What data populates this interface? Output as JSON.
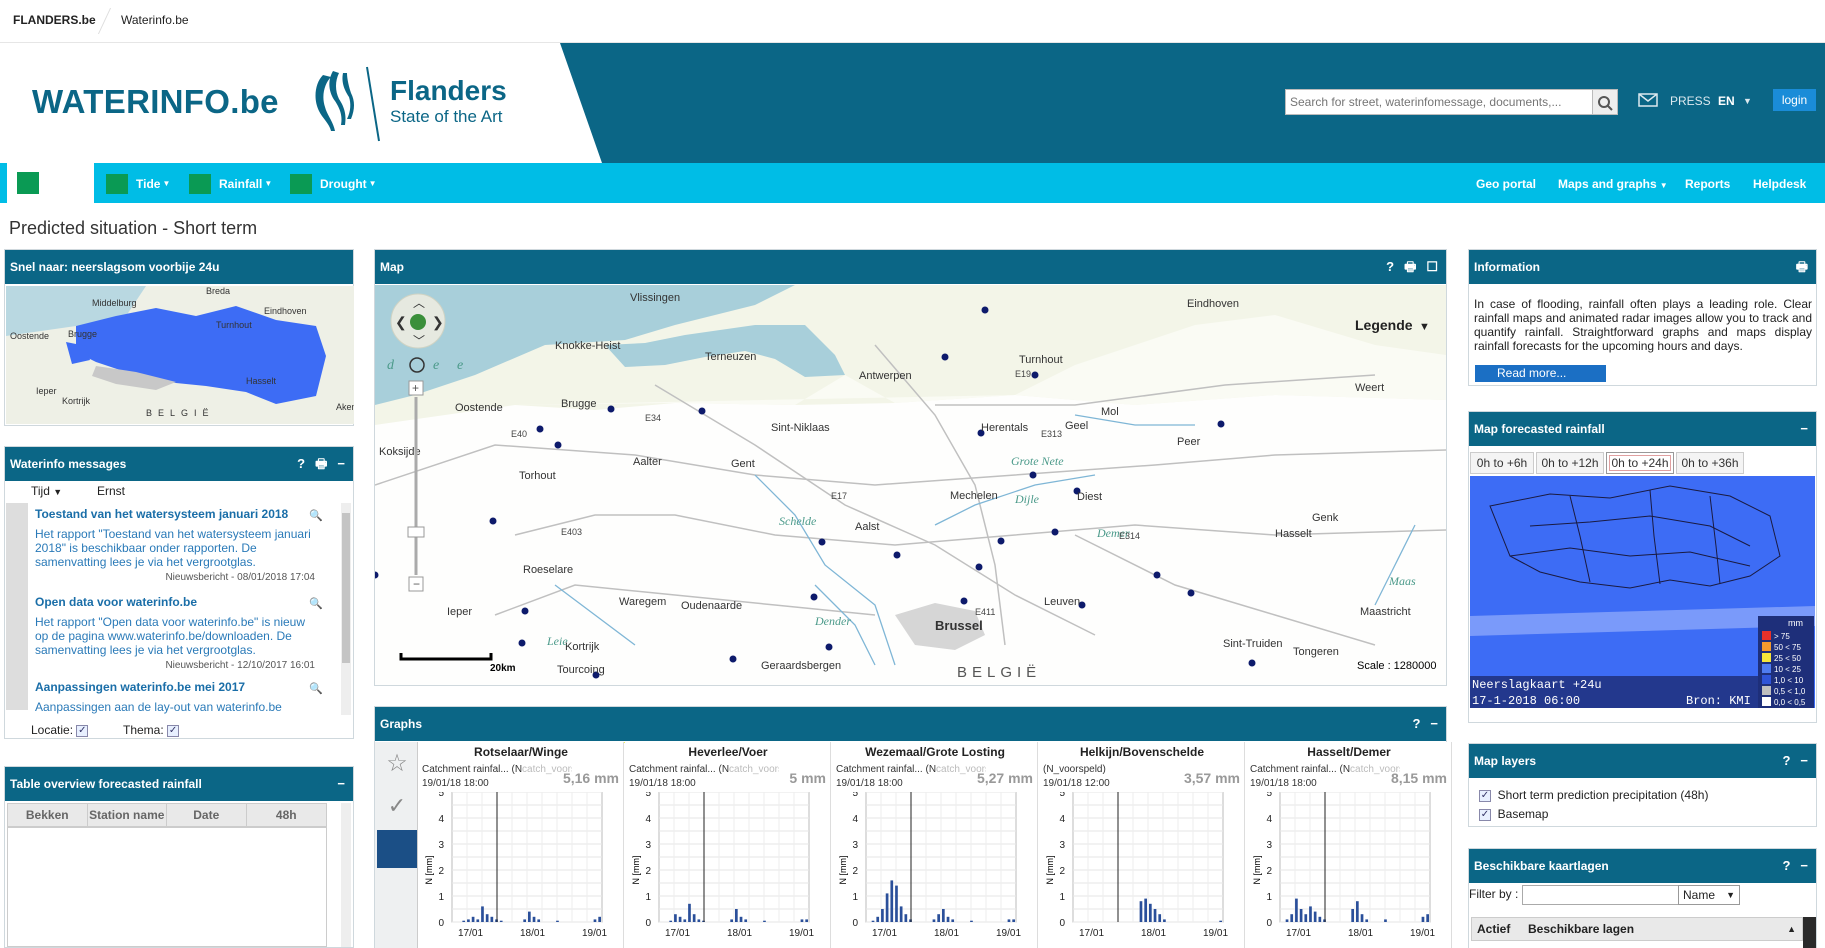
{
  "topbar": {
    "flanders": "FLANDERS.be",
    "waterinfo": "Waterinfo.be"
  },
  "header": {
    "brand": "WATERINFO.be",
    "flanders": "Flanders",
    "state_of_art": "State of the Art",
    "search_placeholder": "Search for street, waterinfomessage, documents,...",
    "press": "PRESS",
    "lang": "EN",
    "login": "login"
  },
  "nav": {
    "items": [
      {
        "label": "Tide"
      },
      {
        "label": "Rainfall"
      },
      {
        "label": "Drought"
      }
    ],
    "right": [
      {
        "label": "Geo portal"
      },
      {
        "label": "Maps and graphs"
      },
      {
        "label": "Reports"
      },
      {
        "label": "Helpdesk"
      }
    ]
  },
  "page_title": "Predicted situation - Short term",
  "snel": {
    "title": "Snel naar: neerslagsom voorbije 24u",
    "places": [
      "Breda",
      "Middelburg",
      "Eindhoven",
      "Oostende",
      "Brugge",
      "Turnhout",
      "Hasselt",
      "Ieper",
      "Kortrijk",
      "BELGIË",
      "Aken"
    ]
  },
  "messages": {
    "title": "Waterinfo messages",
    "col_tijd": "Tijd",
    "col_ernst": "Ernst",
    "items": [
      {
        "title": "Toestand van het watersysteem januari 2018",
        "body": "Het rapport \"Toestand van het watersysteem januari 2018\" is beschikbaar onder rapporten. De samenvatting lees je via het vergrootglas.",
        "date": "Nieuwsbericht - 08/01/2018 17:04"
      },
      {
        "title": "Open data voor waterinfo.be",
        "body": "Het rapport \"Open data voor waterinfo.be\" is nieuw op de pagina www.waterinfo.be/downloaden. De samenvatting lees je via het vergrootglas.",
        "date": "Nieuwsbericht - 12/10/2017 16:01"
      },
      {
        "title": "Aanpassingen waterinfo.be mei 2017",
        "body": "Aanpassingen aan de lay-out van waterinfo.be",
        "date": ""
      }
    ],
    "locatie": "Locatie:",
    "thema": "Thema:"
  },
  "table_overview": {
    "title": "Table overview forecasted rainfall",
    "columns": [
      "Bekken",
      "Station name",
      "Date",
      "48h"
    ]
  },
  "map": {
    "title": "Map",
    "legend": "Legende",
    "scale": "Scale : 1280000",
    "scalebar": "20km",
    "nav_letters": [
      "d",
      "e",
      "e"
    ],
    "cities": [
      "Vlissingen",
      "Knokke-Heist",
      "Terneuzen",
      "Eindhoven",
      "Antwerpen",
      "Turnhout",
      "Oostende",
      "Brugge",
      "Sint-Niklaas",
      "Herentals",
      "Geel",
      "Mol",
      "Weert",
      "Koksijde",
      "Aalter",
      "Gent",
      "Peer",
      "Torhout",
      "Mechelen",
      "Diest",
      "Genk",
      "Roeselare",
      "Aalst",
      "Hasselt",
      "Waregem",
      "Oudenaarde",
      "Leuven",
      "Maastricht",
      "Ieper",
      "Brussel",
      "Kortrijk",
      "Sint-Truiden",
      "Tourcoing",
      "Geraardsbergen",
      "Tongeren",
      "BELGIË"
    ],
    "rivers": [
      "Grote Nete",
      "Dijle",
      "Demer",
      "Schelde",
      "Dender",
      "Leie",
      "Maas"
    ],
    "roads": [
      "E34",
      "E40",
      "E17",
      "E19",
      "E313",
      "E314",
      "E403",
      "E411"
    ]
  },
  "graphs": {
    "title": "Graphs",
    "cards": [
      {
        "title": "Rotselaar/Winge",
        "sub1": "Catchment rainfal... (N",
        "sub1b": "catch_voorspeld)",
        "sub2": "19/01/18 18:00",
        "mm": "5,16 mm",
        "bars": [
          0,
          0,
          0.05,
          0.1,
          0.2,
          0.1,
          0.6,
          0.3,
          0.2,
          0.1,
          0.05,
          0,
          0,
          0,
          0,
          0.1,
          0.4,
          0.2,
          0.1,
          0,
          0,
          0,
          0.05,
          0,
          0,
          0,
          0,
          0,
          0,
          0,
          0.1,
          0.2
        ]
      },
      {
        "title": "Heverlee/Voer",
        "sub1": "Catchment rainfal... (N",
        "sub1b": "catch_voorspeld)",
        "sub2": "19/01/18 18:00",
        "mm": "5 mm",
        "bars": [
          0,
          0,
          0.05,
          0.3,
          0.2,
          0.1,
          0.7,
          0.3,
          0.1,
          0.05,
          0,
          0,
          0,
          0,
          0,
          0.1,
          0.5,
          0.2,
          0.1,
          0,
          0,
          0,
          0.05,
          0,
          0,
          0,
          0,
          0,
          0,
          0,
          0.1,
          0.1
        ]
      },
      {
        "title": "Wezemaal/Grote Losting",
        "sub1": "Catchment rainfal... (N",
        "sub1b": "catch_voorspeld)",
        "sub2": "19/01/18 18:00",
        "mm": "5,27 mm",
        "bars": [
          0,
          0.05,
          0.2,
          0.5,
          1.1,
          1.6,
          1.4,
          0.6,
          0.3,
          0.1,
          0,
          0,
          0,
          0,
          0.1,
          0.3,
          0.5,
          0.2,
          0.1,
          0,
          0,
          0,
          0.05,
          0,
          0,
          0,
          0,
          0,
          0,
          0,
          0.1,
          0.1
        ]
      },
      {
        "title": "Helkijn/Bovenschelde",
        "sub1": "(N_voorspeld)",
        "sub1b": "",
        "sub2": "19/01/18 12:00",
        "mm": "3,57 mm",
        "bars": [
          0,
          0,
          0,
          0,
          0,
          0,
          0,
          0,
          0,
          0,
          0,
          0,
          0,
          0,
          0.8,
          0.9,
          0.7,
          0.5,
          0.3,
          0.1,
          0,
          0,
          0,
          0,
          0,
          0,
          0,
          0,
          0,
          0,
          0,
          0.05
        ]
      },
      {
        "title": "Hasselt/Demer",
        "sub1": "Catchment rainfal... (N",
        "sub1b": "catch_voorspeld)",
        "sub2": "19/01/18 18:00",
        "mm": "8,15 mm",
        "bars": [
          0,
          0.1,
          0.3,
          0.9,
          0.5,
          0.3,
          0.6,
          0.4,
          0.2,
          0.1,
          0,
          0,
          0,
          0,
          0,
          0.5,
          0.8,
          0.3,
          0.1,
          0,
          0,
          0,
          0.1,
          0,
          0,
          0,
          0,
          0,
          0,
          0,
          0.2,
          0.3
        ]
      }
    ],
    "y_ticks": [
      "5",
      "4",
      "3",
      "2",
      "1",
      "0"
    ],
    "y_label": "N [mm]",
    "x_ticks": [
      "17/01",
      "18/01",
      "19/01"
    ]
  },
  "information": {
    "title": "Information",
    "text": "In case of flooding, rainfall often plays a leading role. Clear rainfall maps and animated radar images allow you to track and quantify rainfall. Straightforward graphs and maps display rainfall forecasts for the upcoming hours and days.",
    "read_more": "Read more..."
  },
  "forecast": {
    "title": "Map forecasted rainfall",
    "tabs": [
      "0h to +6h",
      "0h to +12h",
      "0h to +24h",
      "0h to +36h"
    ],
    "active_tab": 2,
    "legend_title": "mm",
    "legend": [
      "> 75",
      "50 < 75",
      "25 < 50",
      "10 < 25",
      "1,0 < 10",
      "0,5 < 1,0",
      "0,0 < 0,5"
    ],
    "legend_colors": [
      "#e8312a",
      "#f29a2e",
      "#f5e63a",
      "#4f7cf0",
      "#2f54d8",
      "#bfbfbf",
      "#ffffff"
    ],
    "caption1": "Neerslagkaart +24u",
    "caption2": "17-1-2018 06:00",
    "caption3": "Bron: KMI"
  },
  "map_layers": {
    "title": "Map layers",
    "items": [
      "Short term prediction precipitation (48h)",
      "Basemap"
    ]
  },
  "beschikbare": {
    "title": "Beschikbare kaartlagen",
    "filter_label": "Filter by :",
    "select_value": "Name",
    "col_actief": "Actief",
    "col_lagen": "Beschikbare lagen"
  },
  "colors": {
    "header": "#0b6686",
    "nav": "#00bde6",
    "panel_head": "#0b6686",
    "rain_blue": "#3d6cf5"
  }
}
